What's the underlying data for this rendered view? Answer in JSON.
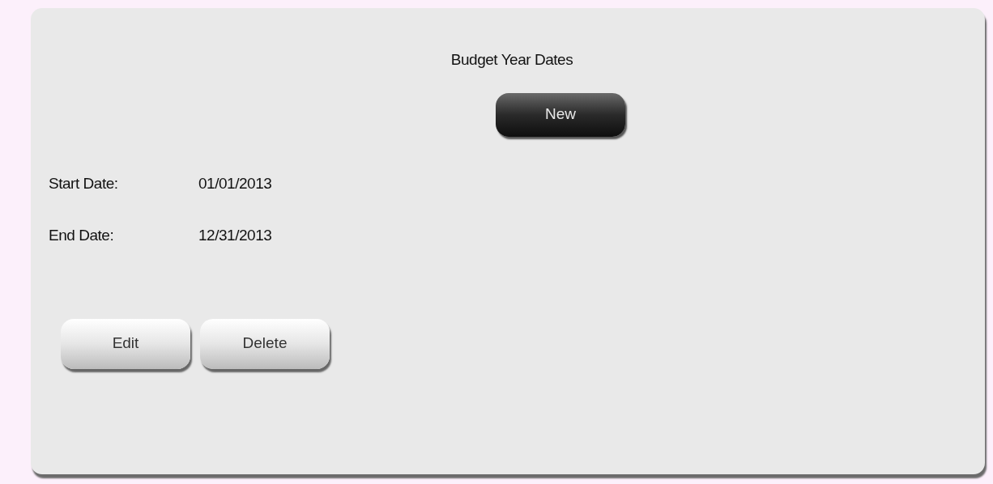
{
  "panel": {
    "title": "Budget Year Dates",
    "new_button": "New",
    "fields": [
      {
        "label": "Start Date:",
        "value": "01/01/2013"
      },
      {
        "label": "End Date:",
        "value": "12/31/2013"
      }
    ],
    "buttons": [
      "Edit",
      "Delete"
    ]
  }
}
